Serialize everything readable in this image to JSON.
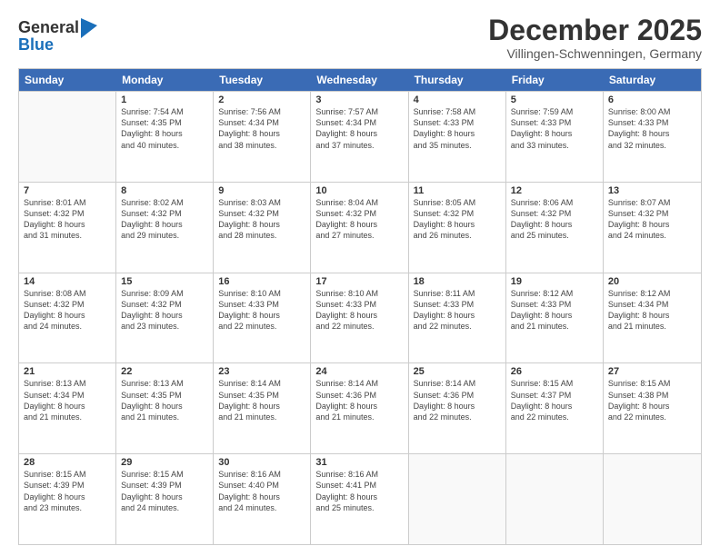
{
  "logo": {
    "general": "General",
    "blue": "Blue"
  },
  "title": "December 2025",
  "location": "Villingen-Schwenningen, Germany",
  "days": [
    "Sunday",
    "Monday",
    "Tuesday",
    "Wednesday",
    "Thursday",
    "Friday",
    "Saturday"
  ],
  "weeks": [
    [
      {
        "day": "",
        "sunrise": "",
        "sunset": "",
        "daylight": "",
        "empty": true
      },
      {
        "day": "1",
        "sunrise": "7:54 AM",
        "sunset": "4:35 PM",
        "daylight": "8 hours and 40 minutes."
      },
      {
        "day": "2",
        "sunrise": "7:56 AM",
        "sunset": "4:34 PM",
        "daylight": "8 hours and 38 minutes."
      },
      {
        "day": "3",
        "sunrise": "7:57 AM",
        "sunset": "4:34 PM",
        "daylight": "8 hours and 37 minutes."
      },
      {
        "day": "4",
        "sunrise": "7:58 AM",
        "sunset": "4:33 PM",
        "daylight": "8 hours and 35 minutes."
      },
      {
        "day": "5",
        "sunrise": "7:59 AM",
        "sunset": "4:33 PM",
        "daylight": "8 hours and 33 minutes."
      },
      {
        "day": "6",
        "sunrise": "8:00 AM",
        "sunset": "4:33 PM",
        "daylight": "8 hours and 32 minutes."
      }
    ],
    [
      {
        "day": "7",
        "sunrise": "8:01 AM",
        "sunset": "4:32 PM",
        "daylight": "8 hours and 31 minutes."
      },
      {
        "day": "8",
        "sunrise": "8:02 AM",
        "sunset": "4:32 PM",
        "daylight": "8 hours and 29 minutes."
      },
      {
        "day": "9",
        "sunrise": "8:03 AM",
        "sunset": "4:32 PM",
        "daylight": "8 hours and 28 minutes."
      },
      {
        "day": "10",
        "sunrise": "8:04 AM",
        "sunset": "4:32 PM",
        "daylight": "8 hours and 27 minutes."
      },
      {
        "day": "11",
        "sunrise": "8:05 AM",
        "sunset": "4:32 PM",
        "daylight": "8 hours and 26 minutes."
      },
      {
        "day": "12",
        "sunrise": "8:06 AM",
        "sunset": "4:32 PM",
        "daylight": "8 hours and 25 minutes."
      },
      {
        "day": "13",
        "sunrise": "8:07 AM",
        "sunset": "4:32 PM",
        "daylight": "8 hours and 24 minutes."
      }
    ],
    [
      {
        "day": "14",
        "sunrise": "8:08 AM",
        "sunset": "4:32 PM",
        "daylight": "8 hours and 24 minutes."
      },
      {
        "day": "15",
        "sunrise": "8:09 AM",
        "sunset": "4:32 PM",
        "daylight": "8 hours and 23 minutes."
      },
      {
        "day": "16",
        "sunrise": "8:10 AM",
        "sunset": "4:33 PM",
        "daylight": "8 hours and 22 minutes."
      },
      {
        "day": "17",
        "sunrise": "8:10 AM",
        "sunset": "4:33 PM",
        "daylight": "8 hours and 22 minutes."
      },
      {
        "day": "18",
        "sunrise": "8:11 AM",
        "sunset": "4:33 PM",
        "daylight": "8 hours and 22 minutes."
      },
      {
        "day": "19",
        "sunrise": "8:12 AM",
        "sunset": "4:33 PM",
        "daylight": "8 hours and 21 minutes."
      },
      {
        "day": "20",
        "sunrise": "8:12 AM",
        "sunset": "4:34 PM",
        "daylight": "8 hours and 21 minutes."
      }
    ],
    [
      {
        "day": "21",
        "sunrise": "8:13 AM",
        "sunset": "4:34 PM",
        "daylight": "8 hours and 21 minutes."
      },
      {
        "day": "22",
        "sunrise": "8:13 AM",
        "sunset": "4:35 PM",
        "daylight": "8 hours and 21 minutes."
      },
      {
        "day": "23",
        "sunrise": "8:14 AM",
        "sunset": "4:35 PM",
        "daylight": "8 hours and 21 minutes."
      },
      {
        "day": "24",
        "sunrise": "8:14 AM",
        "sunset": "4:36 PM",
        "daylight": "8 hours and 21 minutes."
      },
      {
        "day": "25",
        "sunrise": "8:14 AM",
        "sunset": "4:36 PM",
        "daylight": "8 hours and 22 minutes."
      },
      {
        "day": "26",
        "sunrise": "8:15 AM",
        "sunset": "4:37 PM",
        "daylight": "8 hours and 22 minutes."
      },
      {
        "day": "27",
        "sunrise": "8:15 AM",
        "sunset": "4:38 PM",
        "daylight": "8 hours and 22 minutes."
      }
    ],
    [
      {
        "day": "28",
        "sunrise": "8:15 AM",
        "sunset": "4:39 PM",
        "daylight": "8 hours and 23 minutes."
      },
      {
        "day": "29",
        "sunrise": "8:15 AM",
        "sunset": "4:39 PM",
        "daylight": "8 hours and 24 minutes."
      },
      {
        "day": "30",
        "sunrise": "8:16 AM",
        "sunset": "4:40 PM",
        "daylight": "8 hours and 24 minutes."
      },
      {
        "day": "31",
        "sunrise": "8:16 AM",
        "sunset": "4:41 PM",
        "daylight": "8 hours and 25 minutes."
      },
      {
        "day": "",
        "sunrise": "",
        "sunset": "",
        "daylight": "",
        "empty": true
      },
      {
        "day": "",
        "sunrise": "",
        "sunset": "",
        "daylight": "",
        "empty": true
      },
      {
        "day": "",
        "sunrise": "",
        "sunset": "",
        "daylight": "",
        "empty": true
      }
    ]
  ],
  "labels": {
    "sunrise": "Sunrise:",
    "sunset": "Sunset:",
    "daylight": "Daylight:"
  }
}
